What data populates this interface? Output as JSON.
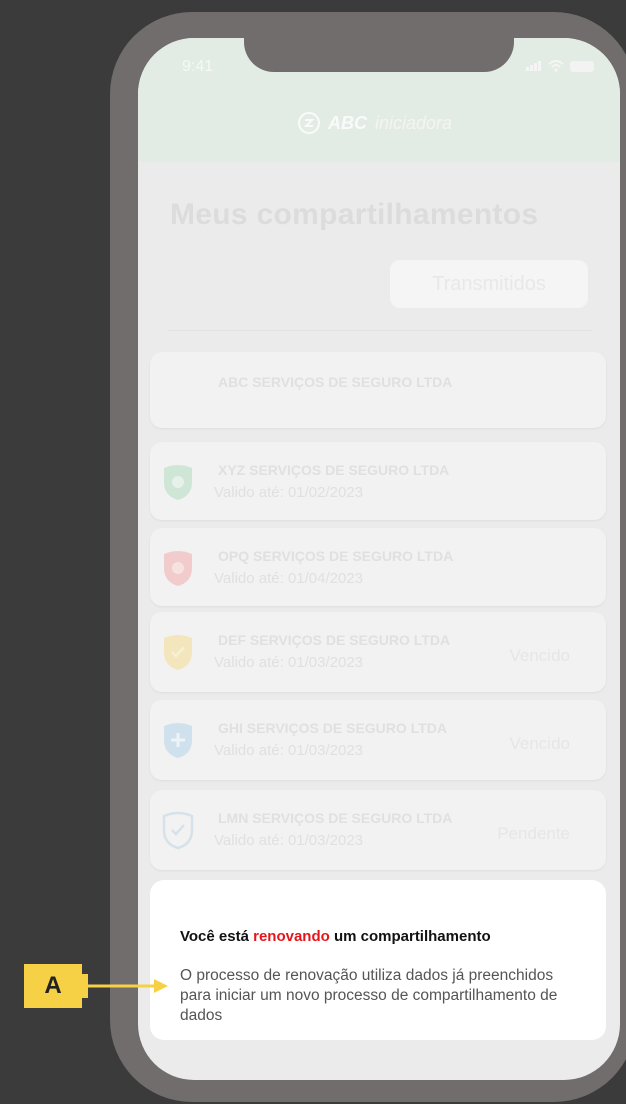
{
  "status_bar": {
    "time": "9:41"
  },
  "header": {
    "logo_brand": "ABC",
    "logo_sub": "iniciadora"
  },
  "page": {
    "title": "Meus compartilhamentos",
    "tab_label": "Transmitidos"
  },
  "cards": [
    {
      "name": "ABC SERVIÇOS DE SEGURO LTDA",
      "date": "",
      "status": "",
      "icon": "none"
    },
    {
      "name": "XYZ SERVIÇOS DE SEGURO LTDA",
      "date": "Valido até: 01/02/2023",
      "status": "",
      "icon": "green-shield-check-icon"
    },
    {
      "name": "OPQ SERVIÇOS DE SEGURO LTDA",
      "date": "Valido até: 01/04/2023",
      "status": "",
      "icon": "red-shield-icon"
    },
    {
      "name": "DEF SERVIÇOS DE SEGURO LTDA",
      "date": "Valido até: 01/03/2023",
      "status": "Vencido",
      "icon": "yellow-shield-check-icon"
    },
    {
      "name": "GHI SERVIÇOS DE SEGURO LTDA",
      "date": "Valido até: 01/03/2023",
      "status": "Vencido",
      "icon": "blue-shield-plus-icon"
    },
    {
      "name": "LMN SERVIÇOS DE SEGURO LTDA",
      "date": "Valido até: 01/03/2023",
      "status": "Pendente",
      "icon": "blue-outline-shield-check-icon"
    }
  ],
  "sheet": {
    "title_prefix": "Você está ",
    "title_highlight": "renovando",
    "title_suffix": " um compartilhamento",
    "body": "O processo de renovação utiliza dados já preenchidos para iniciar um novo processo de compartilhamento de dados"
  },
  "annotation": {
    "label": "A"
  },
  "colors": {
    "background": "#3b3b3b",
    "phone_frame": "#716d6d",
    "header": "#e2ece4",
    "highlight_red": "#e5161b",
    "annotation_yellow": "#f6d146"
  }
}
